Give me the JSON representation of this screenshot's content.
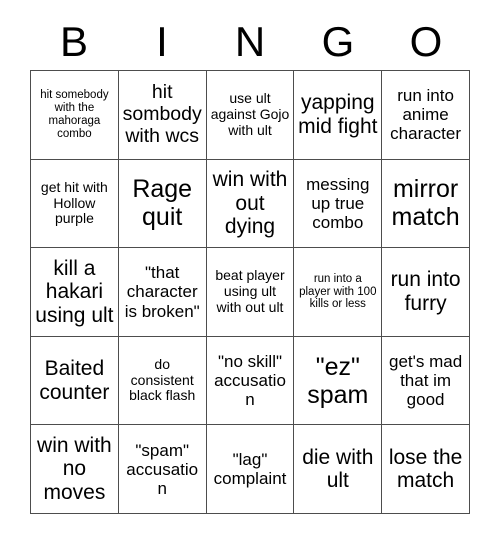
{
  "header": {
    "letters": [
      "B",
      "I",
      "N",
      "G",
      "O"
    ]
  },
  "grid": {
    "rows": 5,
    "columns": 5,
    "border_color": "#4d4d4d",
    "background_color": "#ffffff",
    "text_color": "#000000",
    "cells": [
      [
        {
          "text": "hit somebody with the mahoraga combo",
          "size": "xs"
        },
        {
          "text": "hit sombody with wcs",
          "size": "l"
        },
        {
          "text": "use ult against Gojo with ult",
          "size": "s"
        },
        {
          "text": "yapping mid fight",
          "size": "l"
        },
        {
          "text": "run into anime character",
          "size": "m"
        }
      ],
      [
        {
          "text": "get hit with Hollow purple",
          "size": "s"
        },
        {
          "text": "Rage quit",
          "size": "xl"
        },
        {
          "text": "win with out dying",
          "size": "l"
        },
        {
          "text": "messing up true combo",
          "size": "m"
        },
        {
          "text": "mirror match",
          "size": "xl"
        }
      ],
      [
        {
          "text": "kill a hakari using ult",
          "size": "l"
        },
        {
          "text": "\"that character is broken\"",
          "size": "m"
        },
        {
          "text": "beat player using ult with out ult",
          "size": "s"
        },
        {
          "text": "run into a player with 100 kills or less",
          "size": "xs"
        },
        {
          "text": "run into furry",
          "size": "l"
        }
      ],
      [
        {
          "text": "Baited counter",
          "size": "l"
        },
        {
          "text": "do consistent black flash",
          "size": "s"
        },
        {
          "text": "\"no skill\" accusation",
          "size": "m"
        },
        {
          "text": "\"ez\" spam",
          "size": "xl"
        },
        {
          "text": "get's mad that im good",
          "size": "m"
        }
      ],
      [
        {
          "text": "win with no moves",
          "size": "l"
        },
        {
          "text": "\"spam\" accusation",
          "size": "m"
        },
        {
          "text": "\"lag\" complaint",
          "size": "m"
        },
        {
          "text": "die with ult",
          "size": "l"
        },
        {
          "text": "lose the match",
          "size": "l"
        }
      ]
    ]
  }
}
